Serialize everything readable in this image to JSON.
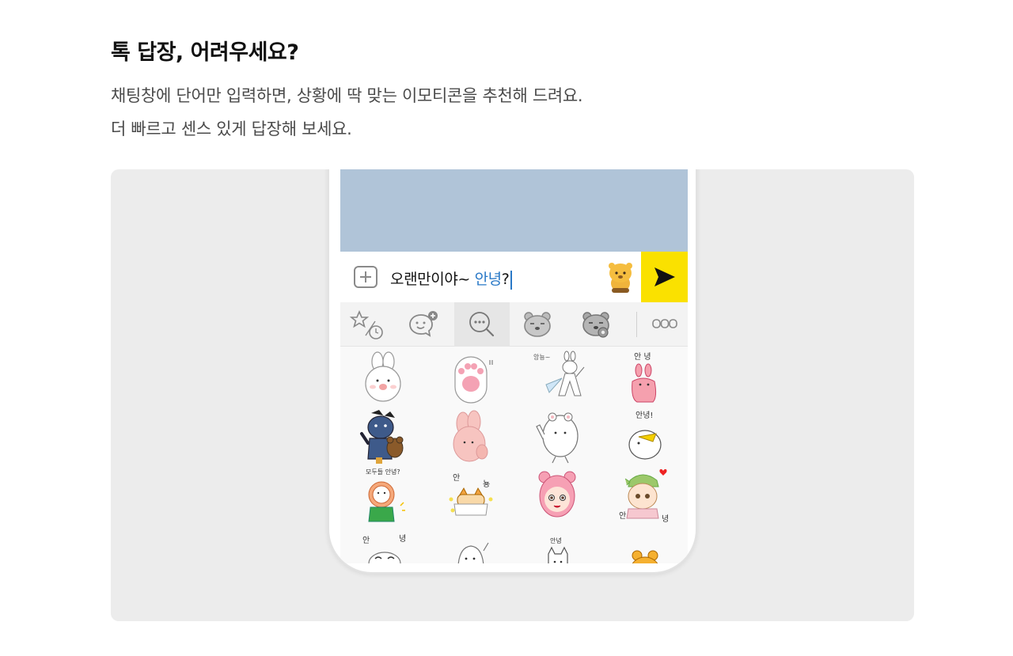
{
  "section": {
    "title": "톡 답장, 어려우세요?",
    "description_lines": [
      "채팅창에 단어만 입력하면, 상황에 딱 맞는 이모티콘을 추천해 드려요.",
      "더 빠르고 센스 있게 답장해 보세요."
    ]
  },
  "chat": {
    "input_prefix": "오랜만이야~ ",
    "input_highlight": "안녕",
    "input_suffix": "?",
    "send_color": "#fae100",
    "chat_bg_color": "#b0c4d8",
    "highlight_color": "#2a79c7"
  },
  "emoticon_tabs": [
    {
      "icon": "star-recent-icon",
      "active": false
    },
    {
      "icon": "chat-bubble-icon",
      "active": false
    },
    {
      "icon": "search-bubble-icon",
      "active": true
    },
    {
      "icon": "bear-face-icon",
      "active": false
    },
    {
      "icon": "bear-camera-icon",
      "active": false
    },
    {
      "icon": "more-icon",
      "active": false
    }
  ],
  "stickers": {
    "captions": {
      "r1c2": "앙뇽~",
      "r1c3": "안 녕",
      "r2c3": "안녕!",
      "r3c0": "모두들 안녕?",
      "r3c1a": "안",
      "r3c1b": "뇽",
      "r3c3a": "안",
      "r3c3b": "녕",
      "r4c0a": "안",
      "r4c0b": "녕",
      "r4c2": "안녕"
    }
  }
}
